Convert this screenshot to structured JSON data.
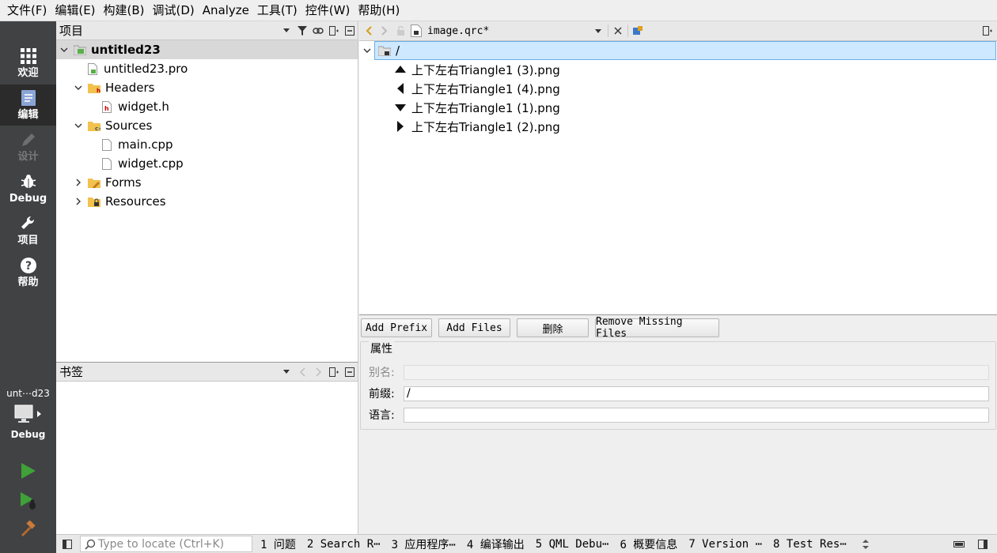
{
  "menu": [
    "文件(F)",
    "编辑(E)",
    "构建(B)",
    "调试(D)",
    "Analyze",
    "工具(T)",
    "控件(W)",
    "帮助(H)"
  ],
  "modes": [
    {
      "label": "欢迎",
      "icon": "grid-icon"
    },
    {
      "label": "编辑",
      "icon": "edit-doc-icon"
    },
    {
      "label": "设计",
      "icon": "pencil-icon"
    },
    {
      "label": "Debug",
      "icon": "bug-icon"
    },
    {
      "label": "项目",
      "icon": "wrench-icon"
    },
    {
      "label": "帮助",
      "icon": "help-icon"
    }
  ],
  "kit": {
    "project": "unt⋯d23",
    "build": "Debug"
  },
  "project_pane": {
    "title": "项目",
    "tree": [
      {
        "label": "untitled23",
        "icon": "project-icon",
        "arrow": "down"
      },
      {
        "label": "untitled23.pro",
        "icon": "pro-file-icon",
        "arrow": ""
      },
      {
        "label": "Headers",
        "icon": "headers-folder-icon",
        "arrow": "down"
      },
      {
        "label": "widget.h",
        "icon": "header-file-icon",
        "arrow": ""
      },
      {
        "label": "Sources",
        "icon": "sources-folder-icon",
        "arrow": "down"
      },
      {
        "label": "main.cpp",
        "icon": "cpp-file-icon",
        "arrow": ""
      },
      {
        "label": "widget.cpp",
        "icon": "cpp-file-icon",
        "arrow": ""
      },
      {
        "label": "Forms",
        "icon": "forms-folder-icon",
        "arrow": "right"
      },
      {
        "label": "Resources",
        "icon": "resources-folder-icon",
        "arrow": "right"
      }
    ]
  },
  "bookmarks_pane": {
    "title": "书签"
  },
  "editor": {
    "file": "image.qrc*",
    "root": "/",
    "resources": [
      {
        "label": "上下左右Triangle1 (3).png",
        "icon": "triangle-up-icon"
      },
      {
        "label": "上下左右Triangle1 (4).png",
        "icon": "triangle-left-icon"
      },
      {
        "label": "上下左右Triangle1 (1).png",
        "icon": "triangle-down-icon"
      },
      {
        "label": "上下左右Triangle1 (2).png",
        "icon": "triangle-right-icon"
      }
    ],
    "buttons": [
      "Add Prefix",
      "Add Files",
      "删除",
      "Remove Missing Files"
    ],
    "props": {
      "title": "属性",
      "alias_label": "别名:",
      "alias_value": "",
      "prefix_label": "前缀:",
      "prefix_value": "/",
      "lang_label": "语言:",
      "lang_value": ""
    }
  },
  "statusbar": {
    "search_placeholder": "Type to locate (Ctrl+K)",
    "tabs": [
      "1 问题",
      "2 Search R⋯",
      "3 应用程序⋯",
      "4 编译输出",
      "5 QML Debu⋯",
      "6 概要信息",
      "7 Version ⋯",
      "8 Test Res⋯"
    ]
  },
  "colors": {
    "modebar": "#404244",
    "selection": "#cde8ff",
    "accent": "#3fa137"
  }
}
